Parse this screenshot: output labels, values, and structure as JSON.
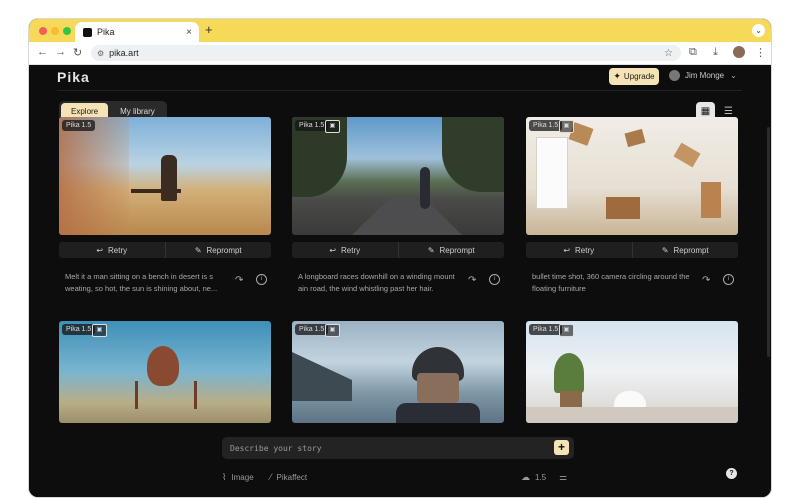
{
  "browser": {
    "tab_title": "Pika",
    "url": "pika.art",
    "newtab_icon": "+",
    "close_icon": "×"
  },
  "header": {
    "logo": "Pika",
    "upgrade_label": "Upgrade",
    "user_name": "Jim Monge"
  },
  "nav": {
    "explore_label": "Explore",
    "library_label": "My library"
  },
  "cards": [
    {
      "badge": "Pika 1.5",
      "retry": "Retry",
      "reprompt": "Reprompt",
      "desc": "Melt it a man sitting on a bench in desert is s weating, so hot, the sun is shining about, ne..."
    },
    {
      "badge": "Pika 1.5",
      "retry": "Retry",
      "reprompt": "Reprompt",
      "desc": "A longboard races downhill on a winding mount ain road, the wind whistling past her hair."
    },
    {
      "badge": "Pika 1.5",
      "retry": "Retry",
      "reprompt": "Reprompt",
      "desc": "bullet time shot, 360 camera circling around the floating furniture"
    },
    {
      "badge": "Pika 1.5"
    },
    {
      "badge": "Pika 1.5"
    },
    {
      "badge": "Pika 1.5"
    }
  ],
  "prompt": {
    "placeholder": "Describe your story",
    "image_label": "Image",
    "pikaffect_label": "Pikaffect",
    "model_version": "1.5",
    "help": "?"
  },
  "colors": {
    "accent": "#f6e3b5",
    "tabbar": "#f7d959",
    "background": "#0d0d0d"
  }
}
